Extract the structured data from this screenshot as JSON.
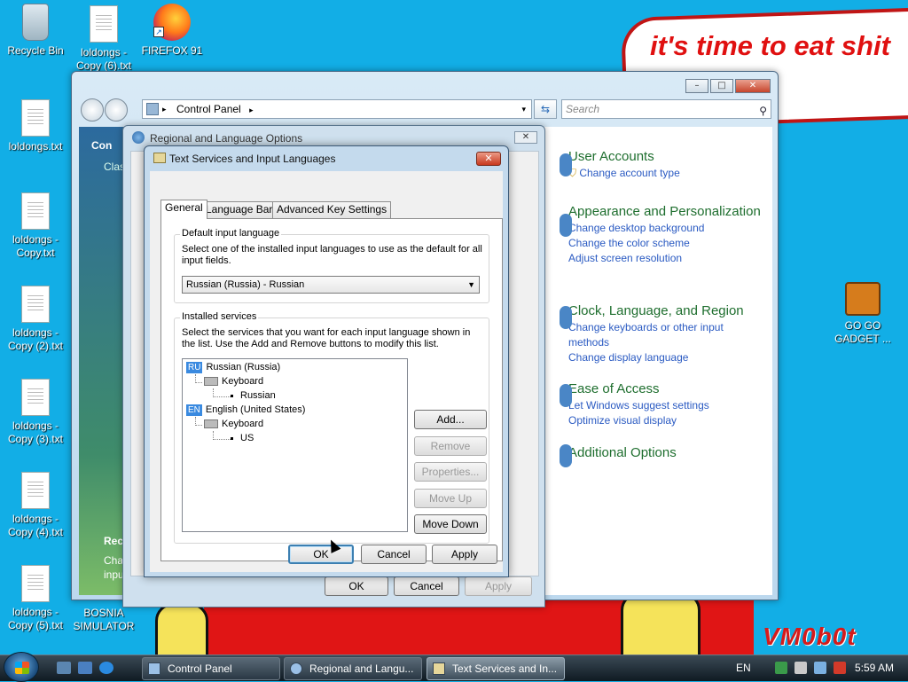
{
  "desktop": {
    "bubble_text": "it's time to eat shit\nand chew\num",
    "watermark": "VM0b0t",
    "icons": [
      {
        "label": "Recycle Bin",
        "type": "recycle-bin"
      },
      {
        "label": "loldongs - Copy (6).txt",
        "type": "text-file"
      },
      {
        "label": "FIREFOX 91",
        "type": "firefox"
      },
      {
        "label": "loldongs.txt",
        "type": "text-file"
      },
      {
        "label": "loldongs - Copy.txt",
        "type": "text-file"
      },
      {
        "label": "loldongs - Copy (2).txt",
        "type": "text-file"
      },
      {
        "label": "loldongs - Copy (3).txt",
        "type": "text-file"
      },
      {
        "label": "loldongs - Copy (4).txt",
        "type": "text-file"
      },
      {
        "label": "loldongs - Copy (5).txt",
        "type": "text-file"
      },
      {
        "label": "BOSNIA SIMULATOR",
        "type": "program"
      },
      {
        "label": "GO GO GADGET ...",
        "type": "briefcase"
      }
    ]
  },
  "control_panel": {
    "address": "Control Panel",
    "search_placeholder": "Search",
    "left_fragments": [
      "Con",
      "Clas",
      "Rec",
      "Cha",
      "inpu"
    ],
    "categories": [
      {
        "title": "User Accounts",
        "links": [
          "Change account type"
        ]
      },
      {
        "title": "Appearance and Personalization",
        "links": [
          "Change desktop background",
          "Change the color scheme",
          "Adjust screen resolution"
        ]
      },
      {
        "title": "Clock, Language, and Region",
        "links": [
          "Change keyboards or other input methods",
          "Change display language"
        ]
      },
      {
        "title": "Ease of Access",
        "links": [
          "Let Windows suggest settings",
          "Optimize visual display"
        ]
      },
      {
        "title": "Additional Options",
        "links": []
      }
    ]
  },
  "regional_dialog": {
    "title": "Regional and Language Options",
    "ok": "OK",
    "cancel": "Cancel",
    "apply": "Apply"
  },
  "text_services_dialog": {
    "title": "Text Services and Input Languages",
    "tabs": [
      "General",
      "Language Bar",
      "Advanced Key Settings"
    ],
    "default_group": {
      "legend": "Default input language",
      "description": "Select one of the installed input languages to use as the default for all input fields.",
      "selected": "Russian (Russia) - Russian"
    },
    "services_group": {
      "legend": "Installed services",
      "description": "Select the services that you want for each input language shown in the list. Use the Add and Remove buttons to modify this list.",
      "tree": [
        {
          "code": "RU",
          "language": "Russian (Russia)",
          "category": "Keyboard",
          "layout": "Russian"
        },
        {
          "code": "EN",
          "language": "English (United States)",
          "category": "Keyboard",
          "layout": "US"
        }
      ],
      "buttons": {
        "add": "Add...",
        "remove": "Remove",
        "properties": "Properties...",
        "move_up": "Move Up",
        "move_down": "Move Down"
      }
    },
    "ok": "OK",
    "cancel": "Cancel",
    "apply": "Apply"
  },
  "taskbar": {
    "tasks": [
      "Control Panel",
      "Regional and Langu...",
      "Text Services and In..."
    ],
    "language": "EN",
    "clock": "5:59 AM"
  },
  "colors": {
    "desktop": "#12aee6",
    "link": "#2a5ac2",
    "category": "#1e6e2e",
    "bubble_text": "#e01010"
  }
}
